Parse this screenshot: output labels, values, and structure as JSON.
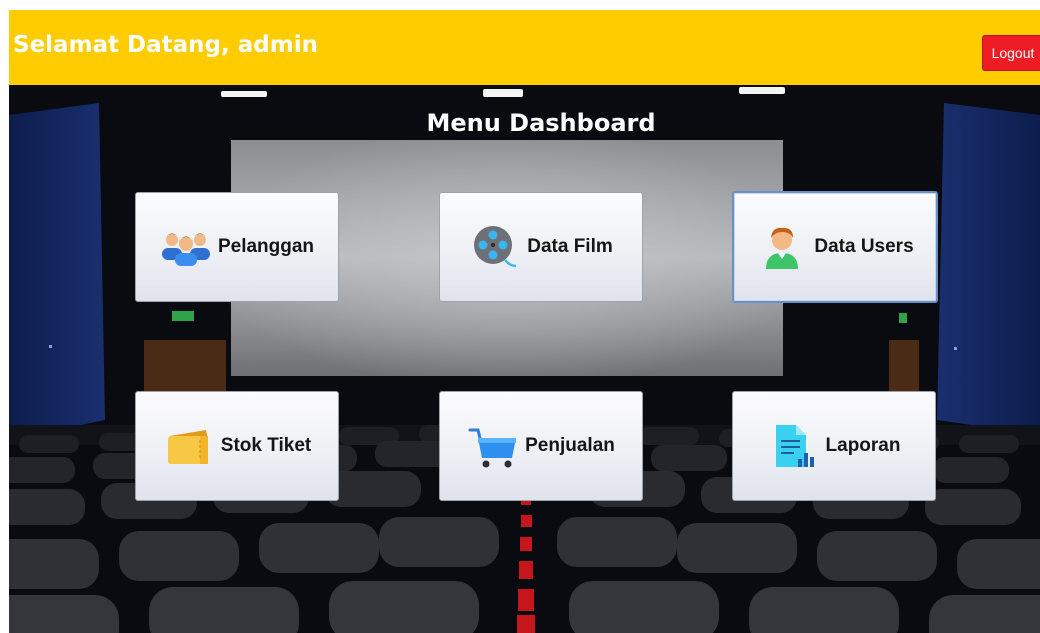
{
  "header": {
    "welcome": "Selamat Datang, admin",
    "logout_label": "Logout",
    "bg_color": "#ffcc00",
    "logout_color": "#ee1c24"
  },
  "dashboard": {
    "title": "Menu Dashboard",
    "menu": [
      {
        "label": "Pelanggan",
        "icon": "people-group-icon"
      },
      {
        "label": "Data Film",
        "icon": "film-reel-icon"
      },
      {
        "label": "Data Users",
        "icon": "user-icon"
      },
      {
        "label": "Stok Tiket",
        "icon": "ticket-icon"
      },
      {
        "label": "Penjualan",
        "icon": "shopping-cart-icon"
      },
      {
        "label": "Laporan",
        "icon": "report-icon"
      }
    ]
  }
}
